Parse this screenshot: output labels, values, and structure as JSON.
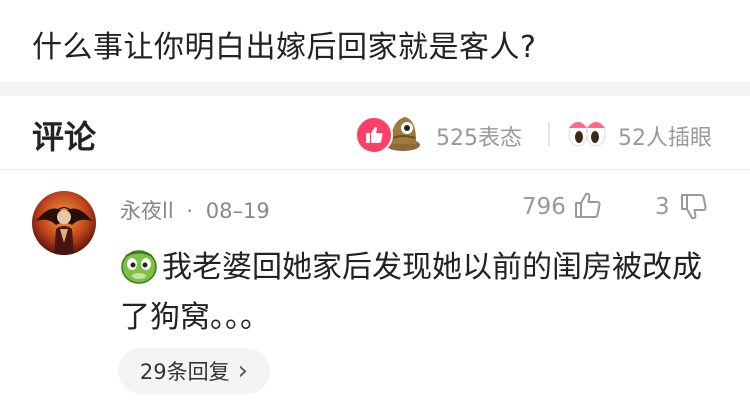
{
  "question": {
    "title": "什么事让你明白出嫁后回家就是客人?"
  },
  "comments_header": {
    "title": "评论",
    "reactions_count": "525表态",
    "views_count": "52人插眼",
    "reaction_icons": [
      "like-icon",
      "hat-emoji-icon"
    ],
    "views_icon": "eyes-icon"
  },
  "comment": {
    "author": "永夜ll",
    "separator": "·",
    "date": "08–19",
    "like_count": "796",
    "dislike_count": "3",
    "emoji": "turtle-face-emoji",
    "text": "我老婆回她家后发现她以前的闺房被改成了狗窝。。。",
    "reply_label": "29条回复",
    "reply_chevron": "›"
  },
  "colors": {
    "like_badge": "#ff3f68",
    "muted_text": "#999999",
    "pill_bg": "#f4f4f5"
  }
}
